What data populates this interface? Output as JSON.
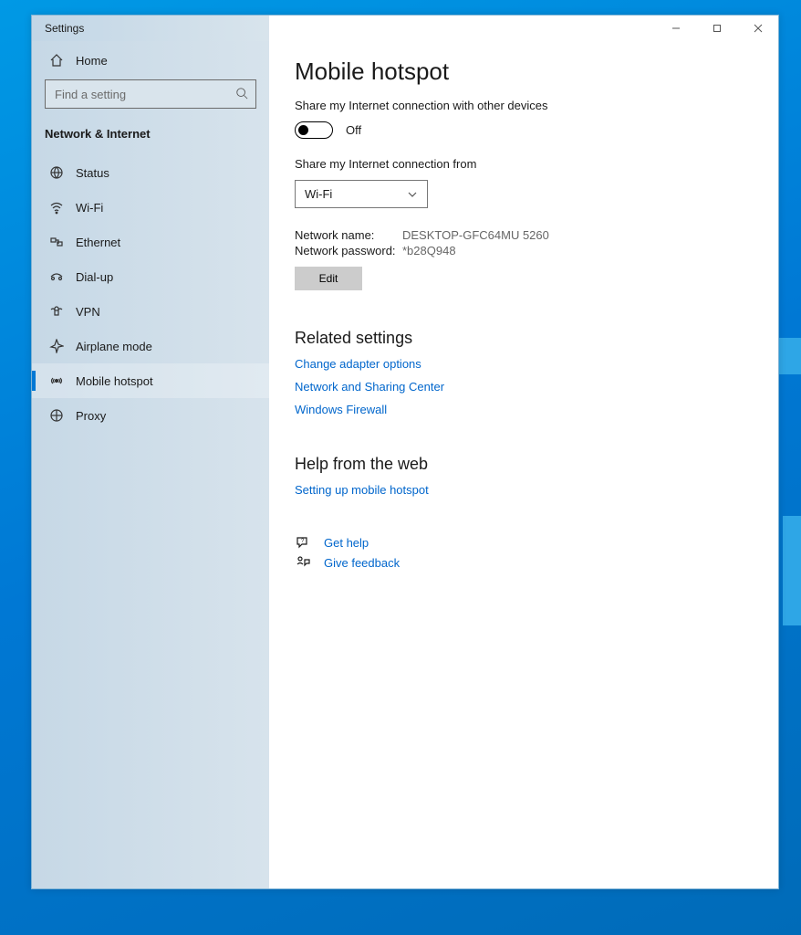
{
  "window": {
    "title": "Settings"
  },
  "sidebar": {
    "home": "Home",
    "search_placeholder": "Find a setting",
    "category": "Network & Internet",
    "items": [
      {
        "icon": "status-icon",
        "label": "Status"
      },
      {
        "icon": "wifi-icon",
        "label": "Wi-Fi"
      },
      {
        "icon": "ethernet-icon",
        "label": "Ethernet"
      },
      {
        "icon": "dialup-icon",
        "label": "Dial-up"
      },
      {
        "icon": "vpn-icon",
        "label": "VPN"
      },
      {
        "icon": "airplane-icon",
        "label": "Airplane mode"
      },
      {
        "icon": "hotspot-icon",
        "label": "Mobile hotspot"
      },
      {
        "icon": "proxy-icon",
        "label": "Proxy"
      }
    ],
    "selected_index": 6
  },
  "main": {
    "title": "Mobile hotspot",
    "share_label": "Share my Internet connection with other devices",
    "toggle_state": "Off",
    "share_from_label": "Share my Internet connection from",
    "share_from_value": "Wi-Fi",
    "network_name_label": "Network name:",
    "network_name_value": "DESKTOP-GFC64MU 5260",
    "network_pw_label": "Network password:",
    "network_pw_value": "*b28Q948",
    "edit_label": "Edit",
    "related_heading": "Related settings",
    "related_links": [
      "Change adapter options",
      "Network and Sharing Center",
      "Windows Firewall"
    ],
    "help_heading": "Help from the web",
    "help_links": [
      "Setting up mobile hotspot"
    ],
    "support": {
      "get_help": "Get help",
      "give_feedback": "Give feedback"
    }
  }
}
